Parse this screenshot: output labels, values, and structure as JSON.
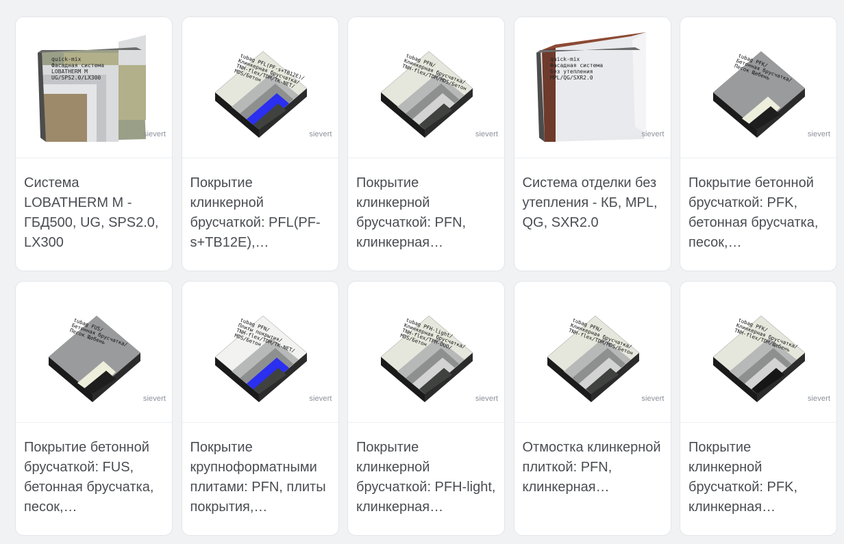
{
  "brand_label": "sievert",
  "colors": {
    "text": "#4a4d52",
    "brand": "#8a8f99",
    "background": "#f1f2f4"
  },
  "cards": [
    {
      "title": "Система LOBATHERM M - ГБД500, UG, SPS2.0, LX300",
      "kind": "wall",
      "annotation": [
        "quick-mix",
        "Фасадная система",
        "LOBATHERM M",
        "UG/SPS2.0/LX300"
      ]
    },
    {
      "title": "Покрытие клинкерной брусчаткой: PFL(PF-s+TB12E),…",
      "kind": "tile-blue",
      "annotation": [
        "tubag PFL(PF-s+TB12E)/",
        "Клинкерная брусчатка/",
        "TNH-flex/TDM/TK-NET/",
        "MDS/Бетон"
      ]
    },
    {
      "title": "Покрытие клинкерной брусчаткой: PFN, клинкерная…",
      "kind": "tile",
      "annotation": [
        "tubag PFN/",
        "Клинкерная брусчатка/",
        "TNH-flex/TDM/MDS/Бетон"
      ]
    },
    {
      "title": "Система отделки без утепления - КБ, MPL, QG, SXR2.0",
      "kind": "wall-brick",
      "annotation": [
        "quick-mix",
        "Фасадная система",
        "без утепления",
        "MPL/QG/SXR2.0"
      ]
    },
    {
      "title": "Покрытие бетонной брусчаткой: PFK, бетонная брусчатка, песок,…",
      "kind": "paver",
      "annotation": [
        "tubag PFK/",
        "Бетонная брусчатка/",
        "Песок Щебень"
      ]
    },
    {
      "title": "Покрытие бетонной брусчаткой: FUS, бетонная брусчатка, песок,…",
      "kind": "paver",
      "annotation": [
        "tubag FUS/",
        "Бетонная брусчатка/",
        "Песок Щебень"
      ]
    },
    {
      "title": "Покрытие крупноформатными плитами: PFN, плиты покрытия,…",
      "kind": "tile-blue-marble",
      "annotation": [
        "tubag PFN/",
        "Плиты покрытия/",
        "TNH-flex/TDM/TK-NET/",
        "MDS/Бетон"
      ]
    },
    {
      "title": "Покрытие клинкерной брусчаткой: PFH-light, клинкерная…",
      "kind": "tile",
      "annotation": [
        "tubag PFH-light/",
        "Клинкерная брусчатка/",
        "TNH-flex/TPM-DUO/",
        "MDS/Бетон"
      ]
    },
    {
      "title": "Отмостка клинкерной плиткой: PFN, клинкерная…",
      "kind": "tile",
      "annotation": [
        "tubag PFN/",
        "Клинкерная брусчатка/",
        "TNH-flex/TDM/MDS/Бетон"
      ]
    },
    {
      "title": "Покрытие клинкерной брусчаткой: PFK, клинкерная…",
      "kind": "tile-dark",
      "annotation": [
        "tubag PFK/",
        "Клинкерная брусчатка/",
        "TNH-flex/TDM/Щебень"
      ]
    }
  ]
}
